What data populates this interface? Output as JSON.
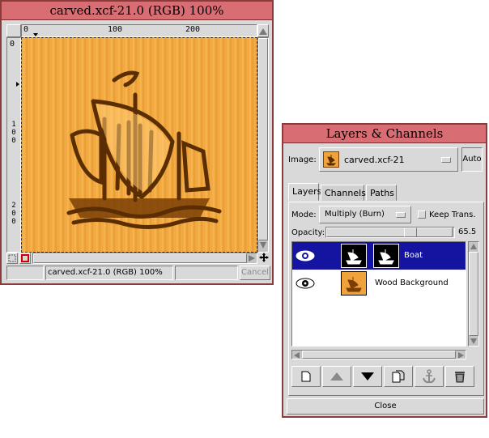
{
  "image_window": {
    "title": "carved.xcf-21.0 (RGB) 100%",
    "ruler_top_labels": [
      "0",
      "100",
      "200"
    ],
    "ruler_left_labels": [
      "0",
      "100",
      "200"
    ],
    "status_text": "carved.xcf-21.0 (RGB) 100%",
    "cancel_label": "Cancel"
  },
  "layers_dialog": {
    "title": "Layers & Channels",
    "image_label": "Image:",
    "image_value": "carved.xcf-21",
    "auto_label": "Auto",
    "tabs": [
      {
        "label": "Layers",
        "active": true
      },
      {
        "label": "Channels",
        "active": false
      },
      {
        "label": "Paths",
        "active": false
      }
    ],
    "mode_label": "Mode:",
    "mode_value": "Multiply (Burn)",
    "keep_trans_label": "Keep Trans.",
    "opacity_label": "Opacity:",
    "opacity_value": "65.5",
    "layers": [
      {
        "name": "Boat",
        "visible": true,
        "selected": true
      },
      {
        "name": "Wood Background",
        "visible": true,
        "selected": false
      }
    ],
    "close_label": "Close"
  },
  "colors": {
    "title_bar": "#d86d73",
    "selection": "#1414a0",
    "wood": "#f0a33a"
  }
}
